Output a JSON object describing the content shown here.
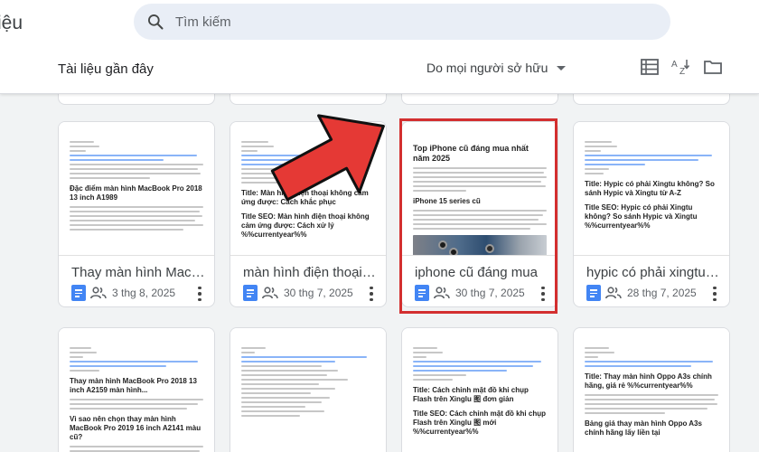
{
  "app": {
    "title_fragment": "iệu"
  },
  "search": {
    "placeholder": "Tìm kiếm"
  },
  "section": {
    "title": "Tài liệu gần đây",
    "owner_filter": "Do mọi người sở hữu"
  },
  "toolbar": {
    "list_view_icon": "list-view-icon",
    "sort_icon": "sort-az-icon",
    "folder_icon": "folder-icon"
  },
  "cards": [
    {
      "title": "Thay màn hình MacBook ...",
      "date": "3 thg 8, 2025",
      "shared": false
    },
    {
      "title": "màn hình điện thoại khôn...",
      "date": "30 thg 7, 2025",
      "shared": true
    },
    {
      "title": "iphone cũ đáng mua",
      "date": "30 thg 7, 2025",
      "shared": true
    },
    {
      "title": "hypic có phải xingtu không",
      "date": "28 thg 7, 2025",
      "shared": false
    }
  ],
  "thumbnails": {
    "card1": {
      "heading1": "Đặc điểm màn hình MacBook Pro 2018 13 inch A1989"
    },
    "card2": {
      "heading1": "Title: Màn hình điện thoại không cảm ứng được: Cách khắc phục",
      "heading2": "Title SEO: Màn hình điện thoại không cảm ứng được: Cách xử lý %%currentyear%%"
    },
    "card3": {
      "heading1": "Top iPhone cũ đáng mua nhất năm 2025",
      "heading2": "iPhone 15 series cũ"
    },
    "card4": {
      "heading1": "Title: Hypic có phải Xingtu không? So sánh Hypic và Xingtu từ A-Z",
      "heading2": "Title SEO: Hypic có phải Xingtu không? So sánh Hypic và Xingtu %%currentyear%%"
    },
    "card5": {
      "heading1": "Thay màn hình MacBook Pro 2018 13 inch A2159 màn hình...",
      "heading2": "Vì sao nên chọn thay màn hình MacBook Pro 2019 16 inch A2141 màu cũ?"
    },
    "card7": {
      "heading1": "Title: Cách chỉnh mặt đồ khi chụp Flash trên Xinglu 图 đơn giản",
      "heading2": "Title SEO: Cách chỉnh mặt đồ khi chụp Flash trên Xinglu 图 mới %%currentyear%%"
    },
    "card8": {
      "heading1": "Title: Thay màn hình Oppo A3s chính hãng, giá rẻ %%currentyear%%",
      "heading2": "Bảng giá thay màn hình Oppo A3s chính hãng lấy liền tại"
    }
  },
  "colors": {
    "highlight_border": "#d32f2f",
    "arrow_fill": "#e53935",
    "docs_blue": "#4285f4"
  }
}
